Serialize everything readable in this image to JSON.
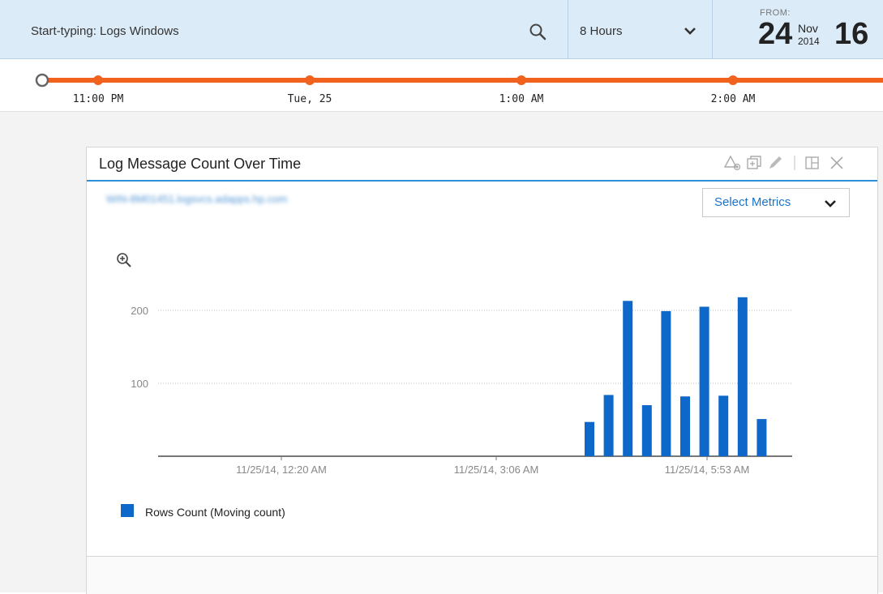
{
  "search": {
    "text": "Start-typing: Logs Windows",
    "icon": "search-icon"
  },
  "range": {
    "value": "8 Hours",
    "icon": "chevron-down-icon"
  },
  "from": {
    "label": "FROM:",
    "day": "24",
    "month": "Nov",
    "year": "2014",
    "hour": "16"
  },
  "timeline": {
    "color": "#f0621e",
    "ticks": [
      "11:00 PM",
      "Tue, 25",
      "1:00 AM",
      "2:00 AM"
    ]
  },
  "widget": {
    "title": "Log Message Count Over Time",
    "subtitle": "WIN-8M01451.logsvcs.adapps.hp.com",
    "actions": [
      "add-alert-icon",
      "duplicate-icon",
      "edit-icon",
      "layout-icon",
      "close-icon"
    ],
    "select_metrics": "Select Metrics",
    "legend_label": "Rows Count (Moving count)",
    "legend_color": "#0e68c9"
  },
  "chart_data": {
    "type": "bar",
    "title": "Log Message Count Over Time",
    "xlabel": "",
    "ylabel": "",
    "ylim": [
      0,
      240
    ],
    "yticks": [
      100,
      200
    ],
    "xtick_labels": [
      "11/25/14, 12:20 AM",
      "11/25/14, 3:06 AM",
      "11/25/14, 5:53 AM"
    ],
    "grid": true,
    "legend_placement": "bottom-left",
    "series": [
      {
        "name": "Rows Count (Moving count)",
        "color": "#0e68c9",
        "values": [
          47,
          84,
          213,
          70,
          199,
          82,
          205,
          83,
          218,
          51
        ]
      }
    ]
  }
}
